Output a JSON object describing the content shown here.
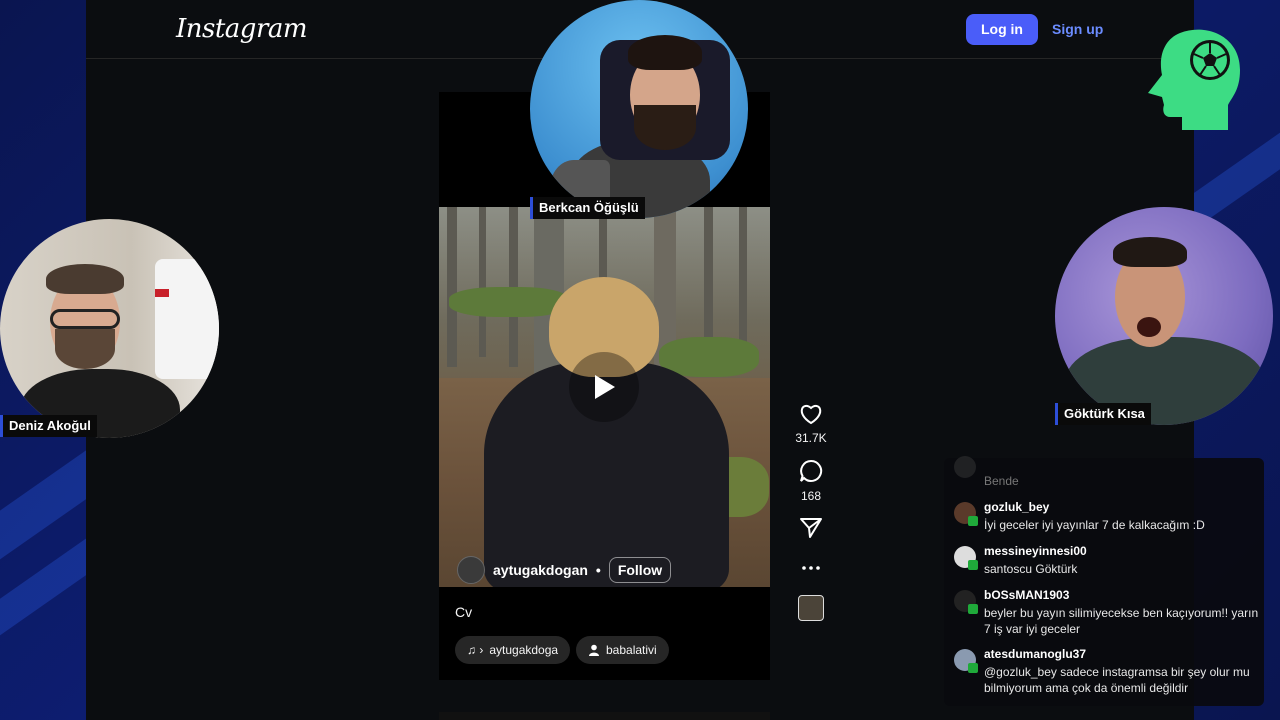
{
  "instagram": {
    "logo": "Instagram",
    "login_label": "Log in",
    "signup_label": "Sign up",
    "reel": {
      "author": "aytugakdogan",
      "separator": "•",
      "follow_label": "Follow",
      "caption": "Cv",
      "audio_chip": "aytugakdoga",
      "audio_prefix": "♫ ›",
      "tag_chip": "babalativi",
      "likes": "31.7K",
      "comments": "168"
    }
  },
  "webcams": [
    {
      "name": "Berkcan Öğüşlü"
    },
    {
      "name": "Deniz Akoğul"
    },
    {
      "name": "Göktürk Kısa"
    }
  ],
  "chat": {
    "partial_message": "Bende",
    "messages": [
      {
        "user": "gozluk_bey",
        "text": "İyi geceler iyi yayınlar 7 de kalkacağım :D"
      },
      {
        "user": "messineyinnesi00",
        "text": "santoscu Göktürk"
      },
      {
        "user": "bOSsMAN1903",
        "text": "beyler bu yayın silimiyecekse ben kaçıyorum!! yarın 7 iş var iyi geceler"
      },
      {
        "user": "atesdumanoglu37",
        "text": "@gozluk_bey sadece instagramsa bir şey olur mu bilmiyorum ama çok da önemli değildir"
      }
    ]
  },
  "colors": {
    "login_button": "#4a5df9",
    "signup_text": "#6b8cff",
    "brand_green": "#3ddc84",
    "stream_bg": "#0d1a5e"
  },
  "icons": {
    "like": "heart-icon",
    "comment": "comment-icon",
    "share": "send-icon",
    "more": "more-icon",
    "play": "play-icon",
    "audio": "music-note-icon",
    "tag": "person-icon",
    "brand": "football-head-icon"
  }
}
